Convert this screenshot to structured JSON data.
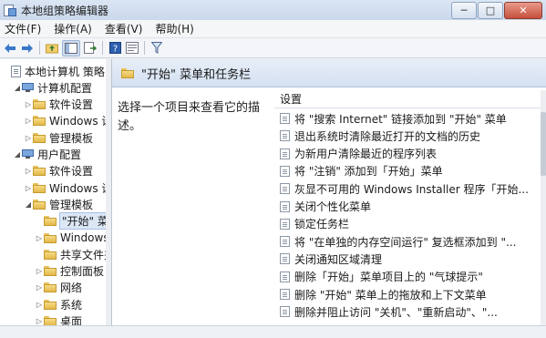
{
  "window": {
    "title": "本地组策略编辑器",
    "controls": [
      "─",
      "□",
      "✕"
    ]
  },
  "menubar": [
    "文件(F)",
    "操作(A)",
    "查看(V)",
    "帮助(H)"
  ],
  "toolbar": {
    "icons": [
      "back-arrow-icon",
      "forward-arrow-icon",
      "up-folder-icon",
      "show-hide-tree-icon",
      "export-list-icon",
      "help-icon",
      "properties-icon",
      "filter-icon"
    ]
  },
  "tree": [
    {
      "label": "本地计算机 策略",
      "depth": 0,
      "toggle": "",
      "icon": "doc",
      "selected": false
    },
    {
      "label": "计算机配置",
      "depth": 1,
      "toggle": "◢",
      "icon": "pc",
      "selected": false
    },
    {
      "label": "软件设置",
      "depth": 2,
      "toggle": "▷",
      "icon": "folder",
      "selected": false
    },
    {
      "label": "Windows 设",
      "depth": 2,
      "toggle": "▷",
      "icon": "folder",
      "selected": false
    },
    {
      "label": "管理模板",
      "depth": 2,
      "toggle": "▷",
      "icon": "folder",
      "selected": false
    },
    {
      "label": "用户配置",
      "depth": 1,
      "toggle": "◢",
      "icon": "pc",
      "selected": false
    },
    {
      "label": "软件设置",
      "depth": 2,
      "toggle": "▷",
      "icon": "folder",
      "selected": false
    },
    {
      "label": "Windows 设",
      "depth": 2,
      "toggle": "▷",
      "icon": "folder",
      "selected": false
    },
    {
      "label": "管理模板",
      "depth": 2,
      "toggle": "◢",
      "icon": "folder",
      "selected": false
    },
    {
      "label": "\"开始\" 菜",
      "depth": 3,
      "toggle": "",
      "icon": "folder",
      "selected": true
    },
    {
      "label": "Windows",
      "depth": 3,
      "toggle": "▷",
      "icon": "folder",
      "selected": false
    },
    {
      "label": "共享文件夹",
      "depth": 3,
      "toggle": "",
      "icon": "folder",
      "selected": false
    },
    {
      "label": "控制面板",
      "depth": 3,
      "toggle": "▷",
      "icon": "folder",
      "selected": false
    },
    {
      "label": "网络",
      "depth": 3,
      "toggle": "▷",
      "icon": "folder",
      "selected": false
    },
    {
      "label": "系统",
      "depth": 3,
      "toggle": "▷",
      "icon": "folder",
      "selected": false
    },
    {
      "label": "桌面",
      "depth": 3,
      "toggle": "▷",
      "icon": "folder",
      "selected": false
    }
  ],
  "right": {
    "header_title": "\"开始\" 菜单和任务栏",
    "description": "选择一个项目来查看它的描述。",
    "list_header": "设置",
    "settings": [
      "将 \"搜索 Internet\" 链接添加到 \"开始\" 菜单",
      "退出系统时清除最近打开的文档的历史",
      "为新用户清除最近的程序列表",
      "将 \"注销\" 添加到「开始」菜单",
      "灰显不可用的 Windows Installer 程序「开始...",
      "关闭个性化菜单",
      "锁定任务栏",
      "将 \"在单独的内存空间运行\" 复选框添加到 \"...",
      "关闭通知区域清理",
      "删除「开始」菜单项目上的 \"气球提示\"",
      "删除 \"开始\" 菜单上的拖放和上下文菜单",
      "删除并阻止访问 \"关机\"、\"重新启动\"、\"..."
    ]
  }
}
